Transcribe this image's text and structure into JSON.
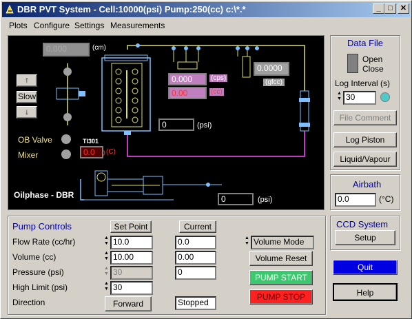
{
  "window": {
    "title": "DBR PVT System - Cell:10000(psi) Pump:250(cc) c:\\*.*",
    "min": "_",
    "max": "□",
    "close": "✕"
  },
  "menu": [
    "Plots",
    "Configure",
    "Settings",
    "Measurements"
  ],
  "diagram": {
    "top_readout": "0.000",
    "top_unit": "(cm)",
    "up_arrow": "↑",
    "slow": "Slow",
    "down_arrow": "↓",
    "ob_valve": "OB Valve",
    "mixer": "Mixer",
    "tag": "TI301",
    "temp_value": "0.0",
    "temp_unit": "(C)",
    "flow_value": "0.000",
    "flow_unit": "(cps)",
    "red_value": "0.00",
    "red_unit": "(cc)",
    "density_value": "0.0000",
    "density_unit": "(gfcc)",
    "cell_pressure": "0",
    "cell_pressure_unit": "(psi)",
    "pump_pressure": "0",
    "pump_pressure_unit": "(psi)",
    "label": "Oilphase - DBR"
  },
  "right": {
    "data_file_title": "Data File",
    "open": "Open",
    "close": "Close",
    "log_interval_label": "Log Interval (s)",
    "log_interval": "30",
    "file_comment": "File Comment",
    "log_piston": "Log Piston",
    "liquid_vapour": "Liquid/Vapour",
    "airbath_title": "Airbath",
    "airbath_value": "0.0",
    "airbath_unit": "(°C)",
    "ccd_title": "CCD System",
    "setup": "Setup",
    "quit": "Quit",
    "help": "Help"
  },
  "pump": {
    "title": "Pump Controls",
    "setpoint_header": "Set Point",
    "current_header": "Current",
    "rows": [
      {
        "label": "Flow Rate (cc/hr)",
        "setpoint": "10.0",
        "current": "0.0"
      },
      {
        "label": "Volume (cc)",
        "setpoint": "10.00",
        "current": "0.00"
      },
      {
        "label": "Pressure (psi)",
        "setpoint": "30",
        "current": "0"
      },
      {
        "label": "High Limit (psi)",
        "setpoint": "30",
        "current": ""
      }
    ],
    "direction_label": "Direction",
    "direction": "Forward",
    "status": "Stopped",
    "mode": "Volume Mode",
    "volume_reset": "Volume Reset",
    "pump_start": "PUMP START",
    "pump_stop": "PUMP STOP"
  },
  "colors": {
    "start": "#3cc86e",
    "stop": "#ff2020",
    "quit": "#0000e0",
    "title_blue": "#0a246a"
  }
}
